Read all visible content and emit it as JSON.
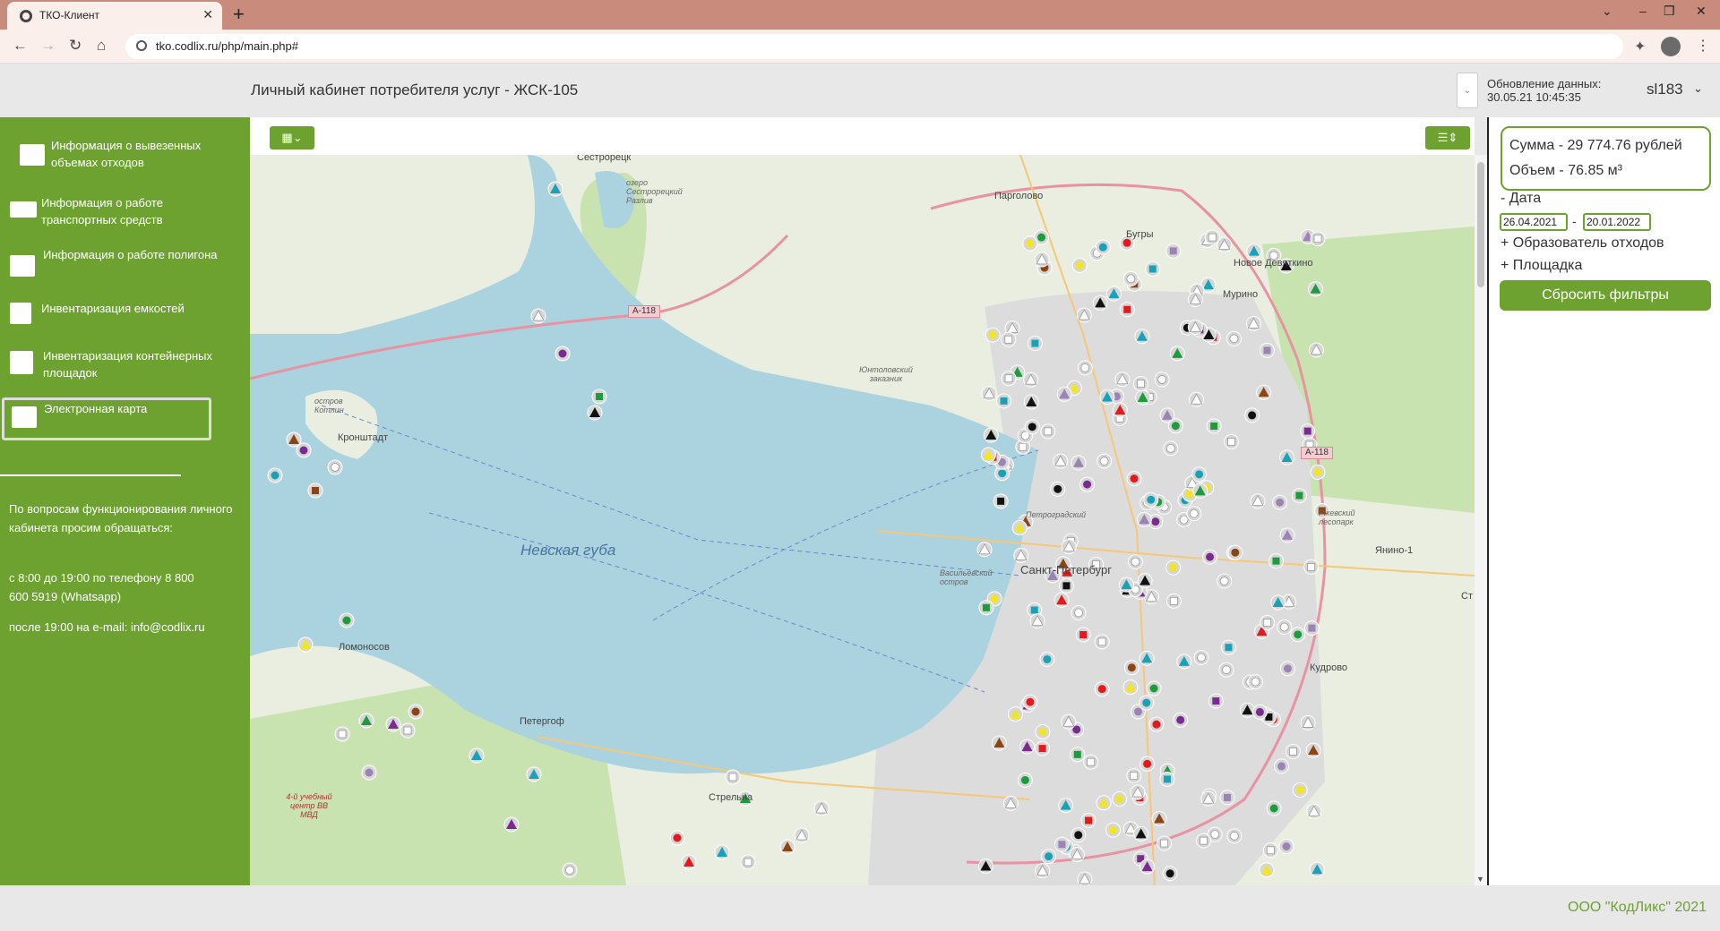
{
  "browser": {
    "tab_title": "ТКО-Клиент",
    "tab_close": "✕",
    "new_tab": "+",
    "url": "tko.codlix.ru/php/main.php#",
    "window_controls": [
      "⌄",
      "–",
      "❐",
      "✕"
    ]
  },
  "header": {
    "title": "Личный кабинет потребителя услуг - ЖСК-105",
    "update_label": "Обновление данных:",
    "update_date": "30.05.21 10:45:35",
    "user": "sl183",
    "user_chevron": "⌄",
    "drop_chevron": "⌄"
  },
  "sidebar": {
    "items": [
      {
        "label": "Информация о вывезенных объемах отходов",
        "icon": "waste-folder-icon"
      },
      {
        "label": "Информация о работе транспортных средств",
        "icon": "truck-icon"
      },
      {
        "label": "Информация о работе полигона",
        "icon": "landfill-folder-icon"
      },
      {
        "label": "Инвентаризация емкостей",
        "icon": "box-icon"
      },
      {
        "label": "Инвентаризация контейнерных площадок",
        "icon": "container-platform-icon"
      },
      {
        "label": "Электронная карта",
        "icon": "map-icon"
      }
    ],
    "support_intro": "По вопросам функционирования личного кабинета просим обращаться:",
    "support_phone": "с 8:00 до 19:00 по телефону 8 800 600 5919 (Whatsapp)",
    "support_email": "после 19:00 на e-mail: info@codlix.ru"
  },
  "map": {
    "layer_button": "▦⌄",
    "list_button": "☰⇕",
    "labels": {
      "sestroretsk": "Сестрорецк",
      "lake": "озеро Сестрорецкий Разлив",
      "pargolovo": "Парголово",
      "bugry": "Бугры",
      "novoe_devyatkino": "Новое Девяткино",
      "murino": "Мурино",
      "yuntolovsky": "Юнтоловский заказник",
      "kotlin": "остров Котлин",
      "kronstadt": "Кронштадт",
      "bay": "Невская губа",
      "spb": "Санкт-Петербург",
      "vasilievsky": "Васильевский остров",
      "petrogradsky": "Петроградский",
      "lomonosov": "Ломоносов",
      "peterhof": "Петергоф",
      "strelna": "Стрельна",
      "rzhevsky": "Ржевский лесопарк",
      "yanino": "Янино-1",
      "kudrovo": "Кудрово",
      "st": "Ст",
      "training": "4-й учебный центр ВВ МВД",
      "road_a118_1": "A-118",
      "road_a118_2": "A-118"
    },
    "colors": {
      "water": "#aad3df",
      "land": "#e9eee0",
      "city": "#dcdcdc",
      "forest": "#c9e3b0",
      "motorway": "#e892a2",
      "road": "#f6c778"
    },
    "marker_colors": {
      "grey": "#bdbdbd",
      "teal": "#17a2b8",
      "purple": "#9b84b5",
      "red": "#e3191b",
      "black": "#111111",
      "yellow": "#f2e524",
      "green": "#1c9c3a",
      "brown": "#8b4513",
      "violet": "#7b2a8f"
    }
  },
  "panel": {
    "sum": "Сумма - 29 774.76 рублей",
    "volume": "Объем - 76.85 м³",
    "date_label": "- Дата",
    "date_from": "26.04.2021",
    "date_sep": "-",
    "date_to": "20.01.2022",
    "generator_label": "+ Образователь отходов",
    "site_label": "+ Площадка",
    "reset_button": "Сбросить фильтры"
  },
  "footer": {
    "text": "ООО \"КодЛикс\" 2021"
  }
}
